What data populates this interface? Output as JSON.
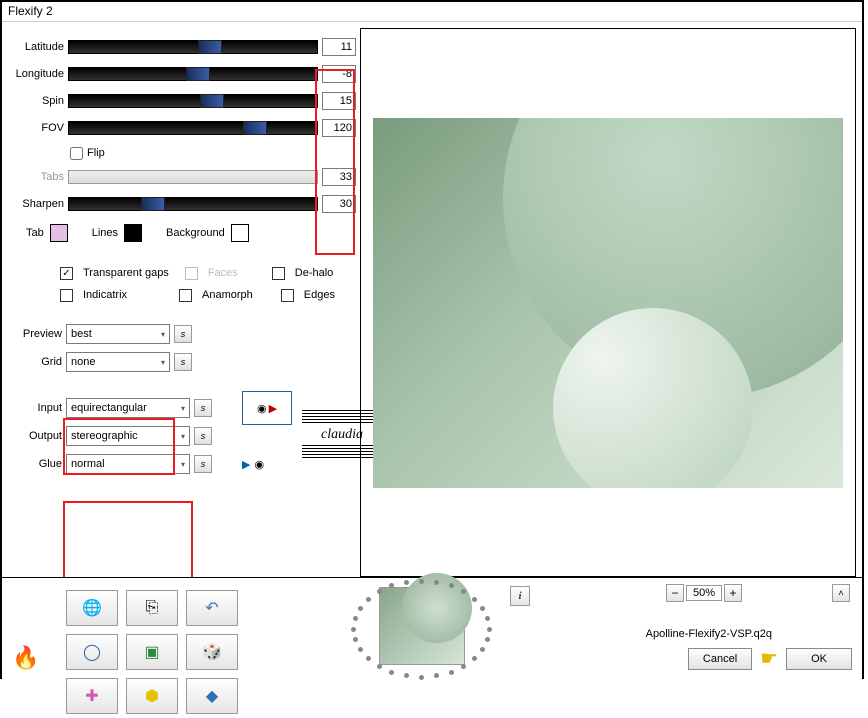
{
  "window": {
    "title": "Flexify 2"
  },
  "sliders": {
    "latitude": {
      "label": "Latitude",
      "value": "11",
      "thumb_pct": 52
    },
    "longitude": {
      "label": "Longitude",
      "value": "-8",
      "thumb_pct": 48
    },
    "spin": {
      "label": "Spin",
      "value": "15",
      "thumb_pct": 53
    },
    "fov": {
      "label": "FOV",
      "value": "120",
      "thumb_pct": 70
    },
    "tabs": {
      "label": "Tabs",
      "value": "33",
      "thumb_pct": 0
    },
    "sharpen": {
      "label": "Sharpen",
      "value": "30",
      "thumb_pct": 30
    }
  },
  "flip": {
    "label": "Flip",
    "checked": false
  },
  "swatches": {
    "tab": {
      "label": "Tab",
      "color": "#e6bfe6"
    },
    "lines": {
      "label": "Lines",
      "color": "#000000"
    },
    "background": {
      "label": "Background",
      "color": "#ffffff"
    }
  },
  "checks": {
    "transparent_gaps": {
      "label": "Transparent gaps",
      "checked": true
    },
    "faces": {
      "label": "Faces",
      "checked": false,
      "disabled": true
    },
    "dehalo": {
      "label": "De-halo",
      "checked": false
    },
    "indicatrix": {
      "label": "Indicatrix",
      "checked": false
    },
    "anamorph": {
      "label": "Anamorph",
      "checked": false
    },
    "edges": {
      "label": "Edges",
      "checked": false
    }
  },
  "selects": {
    "preview": {
      "label": "Preview",
      "value": "best"
    },
    "grid": {
      "label": "Grid",
      "value": "none"
    },
    "input": {
      "label": "Input",
      "value": "equirectangular"
    },
    "output": {
      "label": "Output",
      "value": "stereographic"
    },
    "glue": {
      "label": "Glue",
      "value": "normal"
    }
  },
  "zoom": {
    "value": "50%"
  },
  "filename": "Apolline-Flexify2-VSP.q2q",
  "buttons": {
    "ok": "OK",
    "cancel": "Cancel"
  },
  "watermark": "claudia"
}
